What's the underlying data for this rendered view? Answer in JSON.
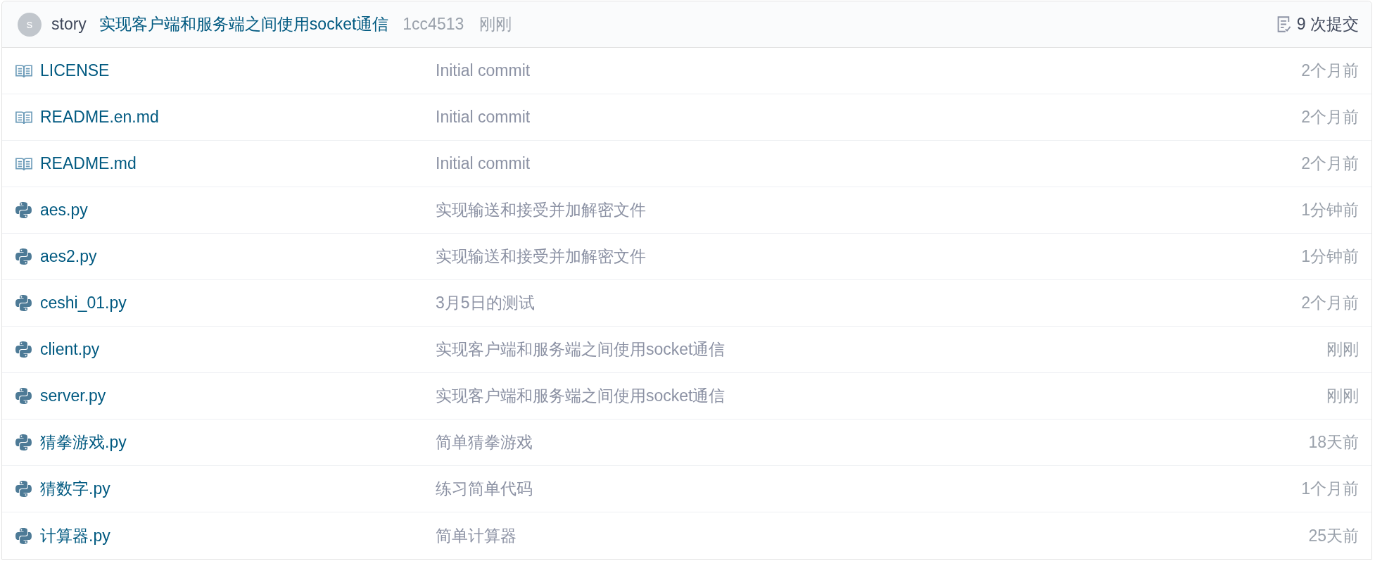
{
  "latest_commit": {
    "avatar": "s",
    "author": "story",
    "message": "实现客户端和服务端之间使用socket通信",
    "sha": "1cc4513",
    "time": "刚刚"
  },
  "commit_count": "9 次提交",
  "files": [
    {
      "kind": "doc",
      "name": "LICENSE",
      "message": "Initial commit",
      "time": "2个月前"
    },
    {
      "kind": "doc",
      "name": "README.en.md",
      "message": "Initial commit",
      "time": "2个月前"
    },
    {
      "kind": "doc",
      "name": "README.md",
      "message": "Initial commit",
      "time": "2个月前"
    },
    {
      "kind": "python",
      "name": "aes.py",
      "message": "实现输送和接受并加解密文件",
      "time": "1分钟前"
    },
    {
      "kind": "python",
      "name": "aes2.py",
      "message": "实现输送和接受并加解密文件",
      "time": "1分钟前"
    },
    {
      "kind": "python",
      "name": "ceshi_01.py",
      "message": "3月5日的测试",
      "time": "2个月前"
    },
    {
      "kind": "python",
      "name": "client.py",
      "message": "实现客户端和服务端之间使用socket通信",
      "time": "刚刚"
    },
    {
      "kind": "python",
      "name": "server.py",
      "message": "实现客户端和服务端之间使用socket通信",
      "time": "刚刚"
    },
    {
      "kind": "python",
      "name": "猜拳游戏.py",
      "message": "简单猜拳游戏",
      "time": "18天前"
    },
    {
      "kind": "python",
      "name": "猜数字.py",
      "message": "练习简单代码",
      "time": "1个月前"
    },
    {
      "kind": "python",
      "name": "计算器.py",
      "message": "简单计算器",
      "time": "25天前"
    }
  ]
}
